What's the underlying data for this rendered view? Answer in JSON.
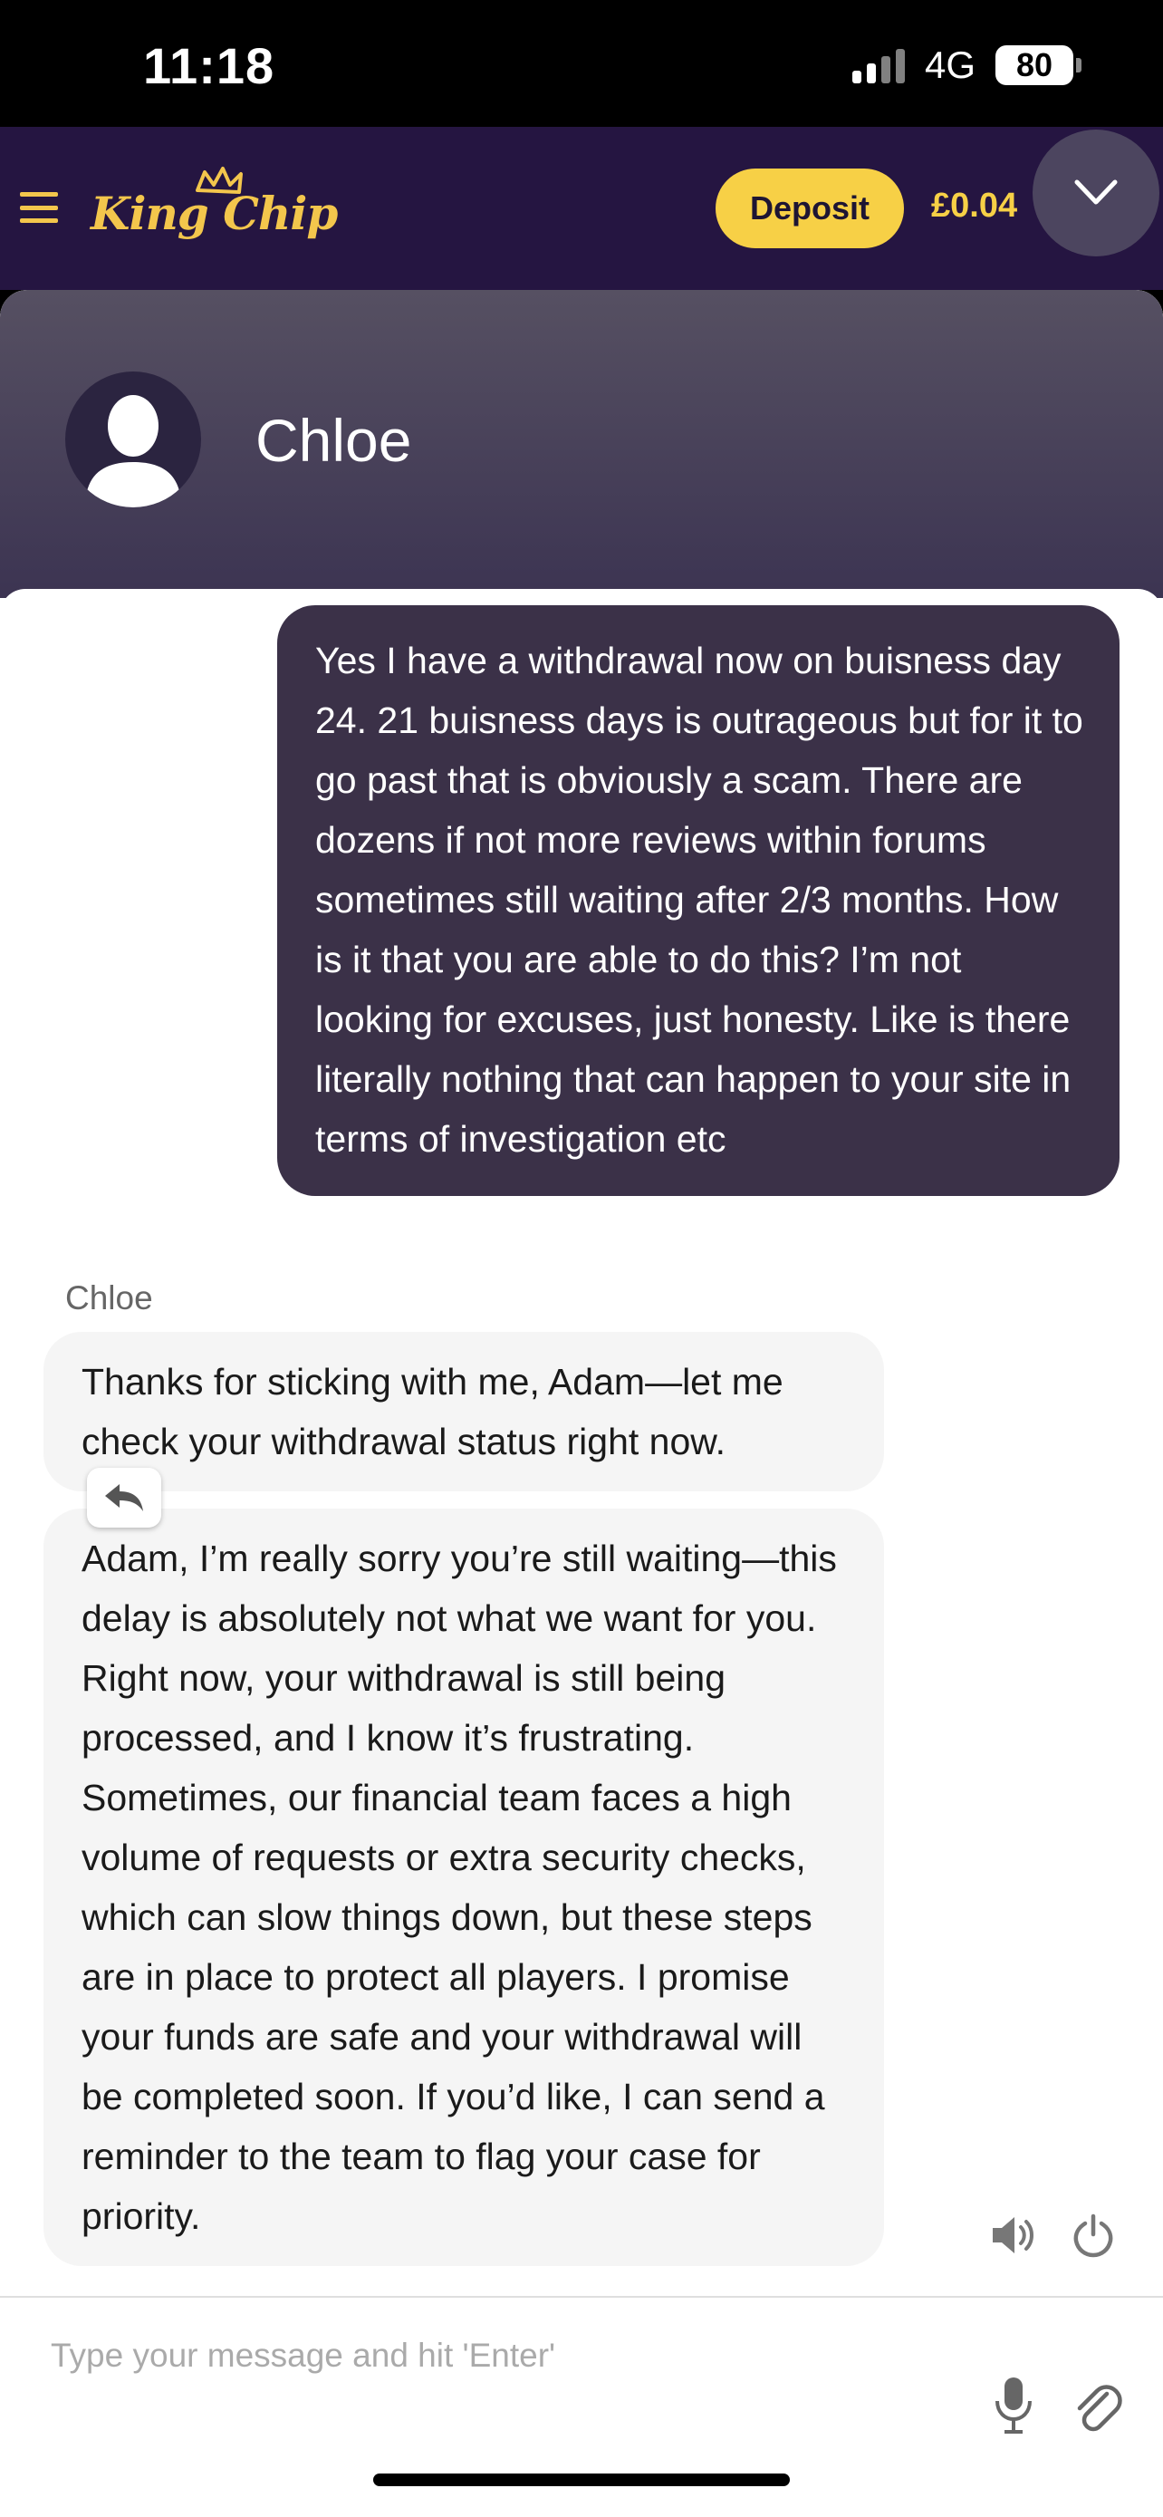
{
  "status_bar": {
    "time": "11:18",
    "network": "4G",
    "battery": "80"
  },
  "header": {
    "logo": "King Chip",
    "deposit_label": "Deposit",
    "balance": "£0.04"
  },
  "chat": {
    "agent_name": "Chloe",
    "messages": [
      {
        "from": "user",
        "text": "Yes I have a withdrawal now on buisness day 24. 21 buisness days is outrageous but for it to go past that is obviously a scam. There are dozens if not more reviews within forums sometimes still waiting after 2/3 months. How is it that you are able to do this? I’m not looking for excuses, just honesty. Like is there literally nothing that can happen to your site in terms of investigation etc"
      },
      {
        "from": "agent",
        "label": "Chloe",
        "text": "Thanks for sticking with me, Adam—let me check your withdrawal status right now."
      },
      {
        "from": "agent",
        "text": "Adam, I’m really sorry you’re still waiting—this delay is absolutely not what we want for you. Right now, your withdrawal is still being processed, and I know it’s frustrating. Sometimes, our financial team faces a high volume of requests or extra security checks, which can slow things down, but these steps are in place to protect all players. I promise your funds are safe and your withdrawal will be completed soon. If you’d like, I can send a reminder to the team to flag your case for priority."
      }
    ],
    "composer": {
      "placeholder": "Type your message and hit 'Enter'"
    },
    "controls": {
      "sound": "speaker-icon",
      "power": "power-icon",
      "mic": "microphone-icon",
      "attach": "paperclip-icon"
    }
  },
  "colors": {
    "header_bg": "#251541",
    "accent_yellow": "#f7d046",
    "user_bubble": "#3b3148",
    "agent_bubble": "#f5f5f5"
  }
}
